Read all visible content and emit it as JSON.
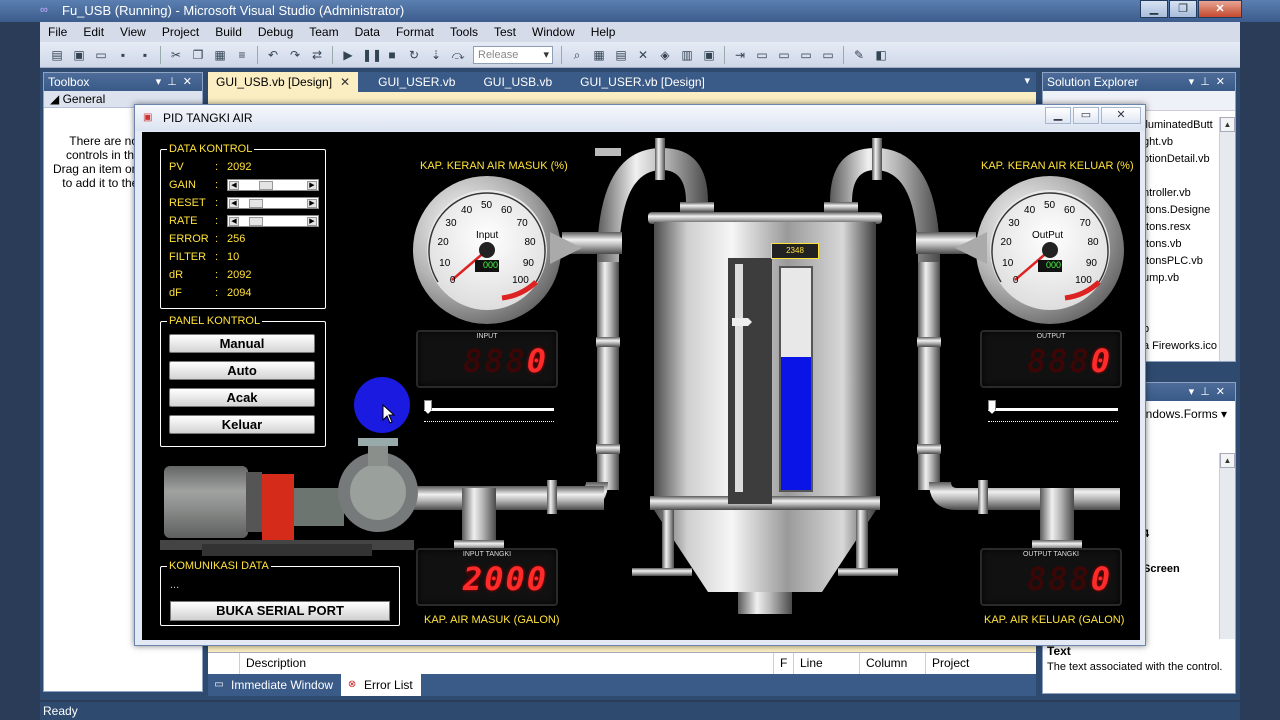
{
  "vs": {
    "title": "Fu_USB (Running) - Microsoft Visual Studio (Administrator)",
    "window_controls": [
      "▁",
      "❐",
      "✕"
    ],
    "menu": [
      "File",
      "Edit",
      "View",
      "Project",
      "Build",
      "Debug",
      "Team",
      "Data",
      "Format",
      "Tools",
      "Test",
      "Window",
      "Help"
    ],
    "config_select": "Release",
    "toolbox": {
      "title": "Toolbox",
      "group": "General",
      "message": "There are no usable controls in this group. Drag an item onto this text to add it to the toolbox."
    },
    "doc_tabs": [
      "GUI_USB.vb [Design]",
      "GUI_USER.vb",
      "GUI_USB.vb",
      "GUI_USER.vb [Design]"
    ],
    "solution_explorer": {
      "title": "Solution Explorer",
      "items": [
        "lluminatedButt",
        "ght.vb",
        "otionDetail.vb",
        "",
        "ntroller.vb",
        "ttons.Designe",
        "ttons.resx",
        "ttons.vb",
        "ttonsPLC.vb",
        "ump.vb",
        "",
        "",
        "b",
        "a Fireworks.ico"
      ]
    },
    "properties": {
      "selected": "indows.Forms",
      "row_a": "4",
      "row_b": "Screen",
      "desc_title": "Text",
      "desc_text": "The text associated with the control."
    },
    "error_list": {
      "columns": [
        "Description",
        "F",
        "Line",
        "Column",
        "Project"
      ]
    },
    "bottom_tabs": [
      "Immediate Window",
      "Error List"
    ],
    "status": "Ready"
  },
  "pid": {
    "title": "PID TANGKI AIR",
    "data_kontrol": {
      "title": "DATA KONTROL",
      "pv": {
        "label": "PV",
        "value": "2092"
      },
      "gain": {
        "label": "GAIN",
        "level": 0.35
      },
      "reset": {
        "label": "RESET",
        "level": 0.15
      },
      "rate": {
        "label": "RATE",
        "level": 0.15
      },
      "error": {
        "label": "ERROR",
        "value": "256"
      },
      "filter": {
        "label": "FILTER",
        "value": "10"
      },
      "dr": {
        "label": "dR",
        "value": "2092"
      },
      "df": {
        "label": "dF",
        "value": "2094"
      }
    },
    "panel_kontrol": {
      "title": "PANEL KONTROL",
      "buttons": [
        "Manual",
        "Auto",
        "Acak",
        "Keluar"
      ]
    },
    "komunikasi": {
      "title": "KOMUNIKASI DATA",
      "status": "...",
      "button": "BUKA SERIAL PORT"
    },
    "gauge_in": {
      "caption": "KAP. KERAN AIR MASUK (%)",
      "label": "Input",
      "odometer": "000",
      "value": 0,
      "ticks": [
        "0",
        "10",
        "20",
        "30",
        "40",
        "50",
        "60",
        "70",
        "80",
        "90",
        "100"
      ]
    },
    "gauge_out": {
      "caption": "KAP. KERAN AIR KELUAR (%)",
      "label": "OutPut",
      "odometer": "000",
      "value": 0,
      "ticks": [
        "0",
        "10",
        "20",
        "30",
        "40",
        "50",
        "60",
        "70",
        "80",
        "90",
        "100"
      ]
    },
    "input_display": {
      "label": "INPUT",
      "value": "0",
      "ghost": "8888"
    },
    "output_display": {
      "label": "OUTPUT",
      "value": "0",
      "ghost": "8888"
    },
    "input_tangki": {
      "label": "INPUT TANGKI",
      "value": "2000",
      "ghost": "8888",
      "caption": "KAP. AIR MASUK (GALON)"
    },
    "output_tangki": {
      "label": "OUTPUT TANGKI",
      "value": "0",
      "ghost": "8888",
      "caption": "KAP. AIR KELUAR (GALON)"
    },
    "slider_in_level": 0,
    "slider_out_level": 0,
    "tank": {
      "readout": "2348",
      "level": 0.6
    },
    "colors": {
      "label": "#ffe23a",
      "segment": "#ff2a2a",
      "water": "#0a14e6"
    }
  }
}
